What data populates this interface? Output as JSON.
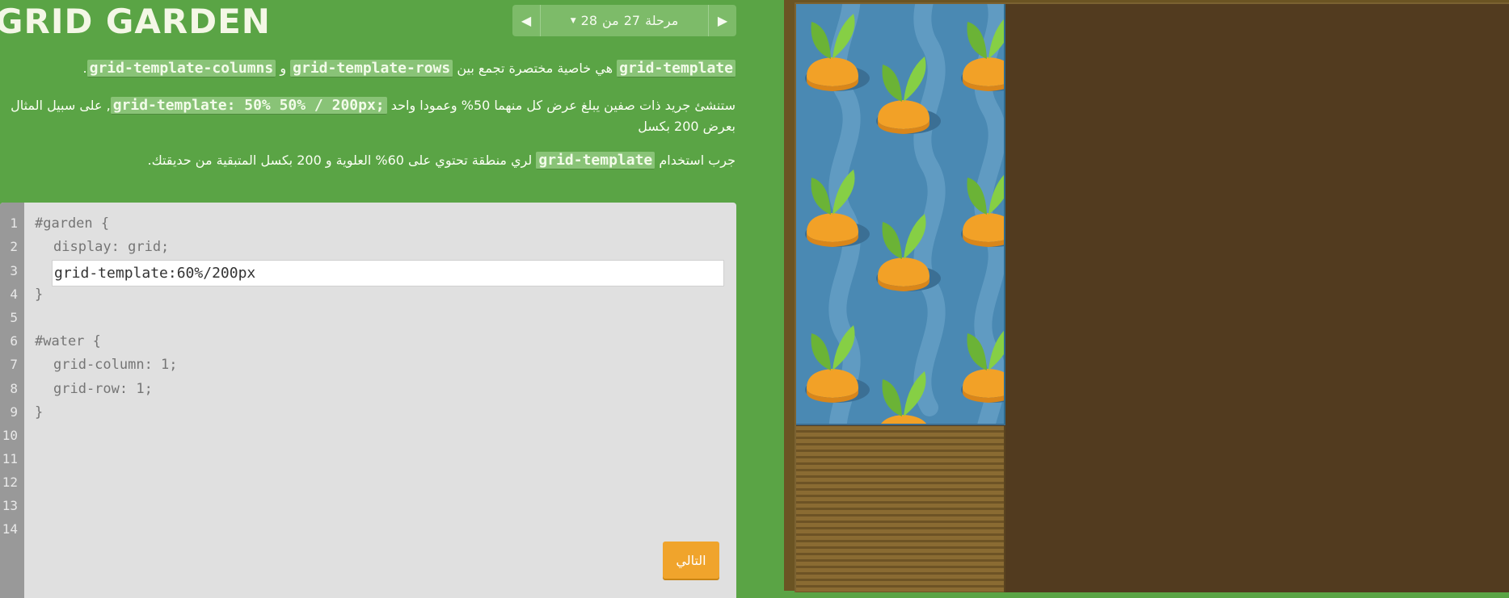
{
  "app": {
    "title": "Grid Garden"
  },
  "level_nav": {
    "prev_icon": "triangle-left-icon",
    "next_icon": "triangle-right-icon",
    "level_label": "مرحلة",
    "current": "27",
    "of_word": "من",
    "total": "28",
    "dropdown_icon": "caret-down-icon"
  },
  "instructions": {
    "p1": {
      "code_a": "grid-template",
      "text_a": "هي خاصية مختصرة تجمع بين",
      "code_b": "grid-template-rows",
      "text_b": "و",
      "code_c": "grid-template-columns",
      "text_c": "."
    },
    "p2": {
      "text_a": "ستنشئ جريد ذات صفين يبلغ عرض كل منهما 50% وعمودا واحد",
      "code_a": "grid-template: 50% 50% / 200px;",
      "text_b": ", على سبيل المثال",
      "text_c": "بعرض 200 بكسل"
    },
    "p3": {
      "text_a": "جرب استخدام",
      "code_a": "grid-template",
      "text_b": "لري منطقة تحتوي على 60% العلوية و 200 بكسل المتبقية من حديقتك."
    }
  },
  "editor": {
    "line_numbers": [
      "1",
      "2",
      "3",
      "4",
      "5",
      "6",
      "7",
      "8",
      "9",
      "10",
      "11",
      "12",
      "13",
      "14"
    ],
    "lines": {
      "l1": "#garden {",
      "l2": "display: grid;",
      "l4": "}",
      "l6": "#water {",
      "l7": "grid-column: 1;",
      "l8": "grid-row: 1;",
      "l9": "}"
    },
    "input_value": "grid-template:60%/200px",
    "next_label": "التالي"
  },
  "garden": {
    "water_icon": "water-tile",
    "carrot_icon": "carrot-icon",
    "soil_icon": "soil-tile"
  },
  "colors": {
    "panel_green": "#5aa445",
    "water_blue": "#4a89b3",
    "soil_brown": "#523b1f",
    "button_orange": "#f0a42c",
    "carrot_orange": "#f2a127",
    "leaf_green": "#7cc63f"
  }
}
